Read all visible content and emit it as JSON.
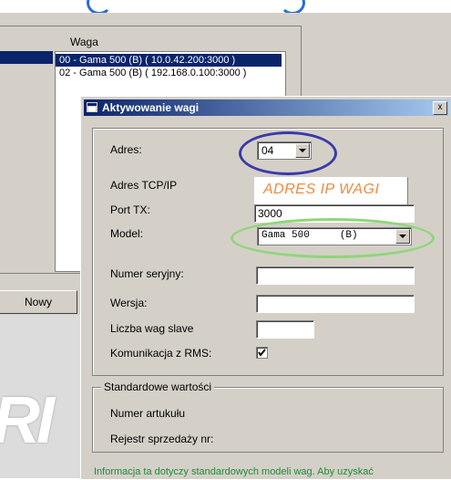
{
  "background": {
    "list_label": "Waga",
    "list_items": [
      {
        "label": "00 - Gama 500 (B) ( 10.0.42.200:3000 )",
        "selected": true
      },
      {
        "label": "02 - Gama 500 (B) ( 192.168.0.100:3000 )",
        "selected": false
      }
    ],
    "new_button": "Nowy"
  },
  "dialog": {
    "title": "Aktywowanie wagi",
    "close_glyph": "x",
    "fields": {
      "adres_label": "Adres:",
      "adres_value": "04",
      "tcp_label": "Adres TCP/IP",
      "tcp_annotation": "ADRES IP WAGI",
      "port_label": "Port TX:",
      "port_value": "3000",
      "model_label": "Model:",
      "model_value": "Gama 500     (B)",
      "serial_label": "Numer seryjny:",
      "serial_value": "",
      "version_label": "Wersja:",
      "version_value": "",
      "slave_label": "Liczba wag slave",
      "slave_value": "",
      "rms_label": "Komunikacja z  RMS:",
      "rms_checked": true
    },
    "standard_group": {
      "title": "Standardowe wartości",
      "article_label": "Numer artukułu",
      "register_label": "Rejestr sprzedaży nr:"
    },
    "info_text": "Informacja ta dotyczy standardowych modeli wag. Aby uzyskać"
  },
  "colors": {
    "title_bar": "#0a246a",
    "annotation_orange": "#f08a3c",
    "oval_blue": "#3a3aa8",
    "oval_green": "#8fd67a",
    "info_green": "#1f8a3a"
  }
}
